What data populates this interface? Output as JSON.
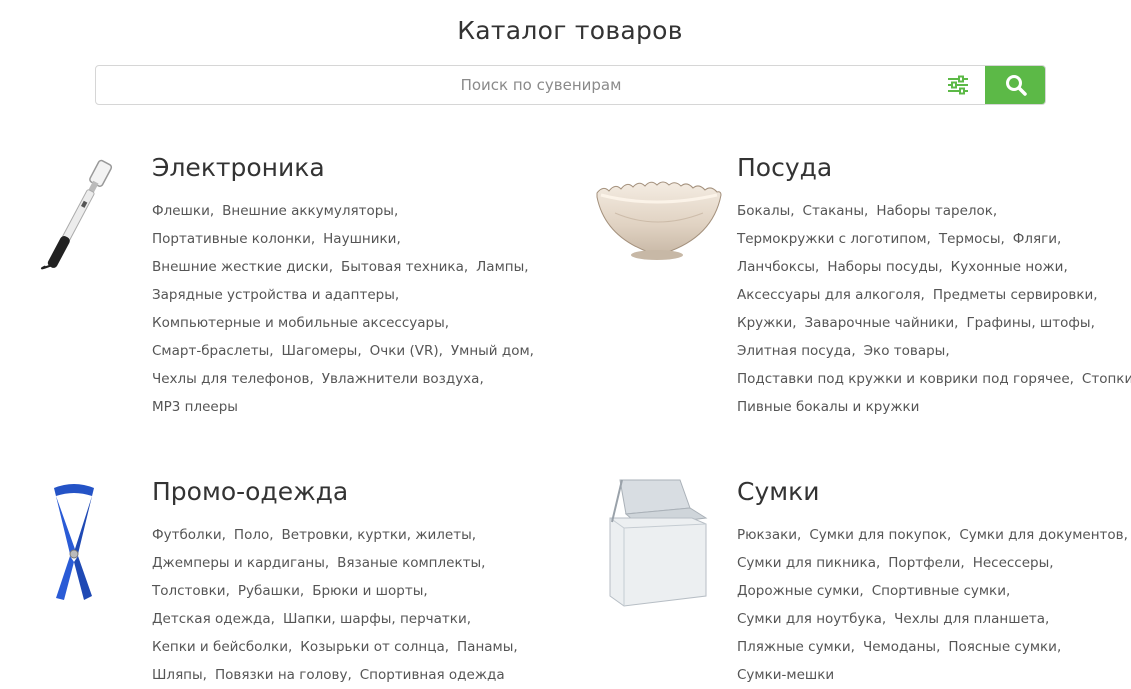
{
  "page": {
    "title": "Каталог товаров"
  },
  "search": {
    "placeholder": "Поиск по сувенирам",
    "accent_color": "#5cb947",
    "filter_icon": "sliders-icon",
    "search_icon": "search-icon"
  },
  "categories": {
    "electronics": {
      "title": "Электроника",
      "image": "selfie-stick",
      "lines": [
        [
          "Флешки",
          "Внешние аккумуляторы"
        ],
        [
          "Портативные колонки",
          "Наушники"
        ],
        [
          "Внешние жесткие диски",
          "Бытовая техника",
          "Лампы"
        ],
        [
          "Зарядные устройства и адаптеры"
        ],
        [
          "Компьютерные и мобильные аксессуары"
        ],
        [
          "Смарт-браслеты",
          "Шагомеры",
          "Очки (VR)",
          "Умный дом"
        ],
        [
          "Чехлы для телефонов",
          "Увлажнители воздуха"
        ],
        [
          "MP3 плееры"
        ]
      ]
    },
    "tableware": {
      "title": "Посуда",
      "image": "glass-bowl",
      "lines": [
        [
          "Бокалы",
          "Стаканы",
          "Наборы тарелок"
        ],
        [
          "Термокружки с логотипом",
          "Термосы",
          "Фляги"
        ],
        [
          "Ланчбоксы",
          "Наборы посуды",
          "Кухонные ножи"
        ],
        [
          "Аксессуары для алкоголя",
          "Предметы сервировки"
        ],
        [
          "Кружки",
          "Заварочные чайники",
          "Графины, штофы"
        ],
        [
          "Элитная посуда",
          "Эко товары"
        ],
        [
          "Подставки под кружки и коврики под горячее",
          "Стопки"
        ],
        [
          "Пивные бокалы и кружки"
        ]
      ]
    },
    "promo_clothing": {
      "title": "Промо-одежда",
      "image": "blue-lanyard",
      "lines": [
        [
          "Футболки",
          "Поло",
          "Ветровки, куртки, жилеты"
        ],
        [
          "Джемперы и кардиганы",
          "Вязаные комплекты"
        ],
        [
          "Толстовки",
          "Рубашки",
          "Брюки и шорты"
        ],
        [
          "Детская одежда",
          "Шапки, шарфы, перчатки"
        ],
        [
          "Кепки и бейсболки",
          "Козырьки от солнца",
          "Панамы"
        ],
        [
          "Шляпы",
          "Повязки на голову",
          "Спортивная одежда"
        ]
      ]
    },
    "bags": {
      "title": "Сумки",
      "image": "cooler-bag",
      "lines": [
        [
          "Рюкзаки",
          "Сумки для покупок",
          "Сумки для документов"
        ],
        [
          "Сумки для пикника",
          "Портфели",
          "Несессеры"
        ],
        [
          "Дорожные сумки",
          "Спортивные сумки"
        ],
        [
          "Сумки для ноутбука",
          "Чехлы для планшета"
        ],
        [
          "Пляжные сумки",
          "Чемоданы",
          "Поясные сумки"
        ],
        [
          "Сумки-мешки"
        ]
      ]
    }
  }
}
